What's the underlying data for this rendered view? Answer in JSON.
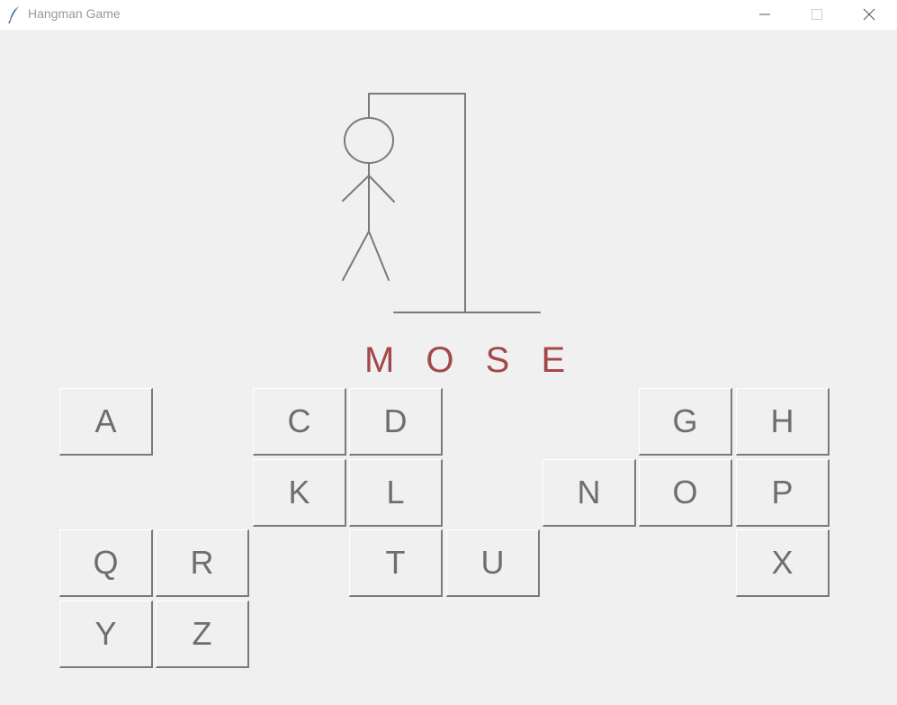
{
  "window": {
    "title": "Hangman Game"
  },
  "game": {
    "word_display": "M O S E",
    "keys": [
      {
        "letter": "A",
        "col": 0,
        "row": 0
      },
      {
        "letter": "C",
        "col": 2,
        "row": 0
      },
      {
        "letter": "D",
        "col": 3,
        "row": 0
      },
      {
        "letter": "G",
        "col": 6,
        "row": 0
      },
      {
        "letter": "H",
        "col": 7,
        "row": 0
      },
      {
        "letter": "K",
        "col": 2,
        "row": 1
      },
      {
        "letter": "L",
        "col": 3,
        "row": 1
      },
      {
        "letter": "N",
        "col": 5,
        "row": 1
      },
      {
        "letter": "O",
        "col": 6,
        "row": 1
      },
      {
        "letter": "P",
        "col": 7,
        "row": 1
      },
      {
        "letter": "Q",
        "col": 0,
        "row": 2
      },
      {
        "letter": "R",
        "col": 1,
        "row": 2
      },
      {
        "letter": "T",
        "col": 3,
        "row": 2
      },
      {
        "letter": "U",
        "col": 4,
        "row": 2
      },
      {
        "letter": "X",
        "col": 7,
        "row": 2
      },
      {
        "letter": "Y",
        "col": 0,
        "row": 3
      },
      {
        "letter": "Z",
        "col": 1,
        "row": 3
      }
    ]
  },
  "icons": {
    "app": "feather-icon",
    "minimize": "minimize-icon",
    "maximize": "maximize-icon",
    "close": "close-icon"
  },
  "colors": {
    "word": "#a4474b",
    "key_text": "#6e6e6e",
    "drawing": "#7a7a7a",
    "background": "#f0f0f0"
  }
}
